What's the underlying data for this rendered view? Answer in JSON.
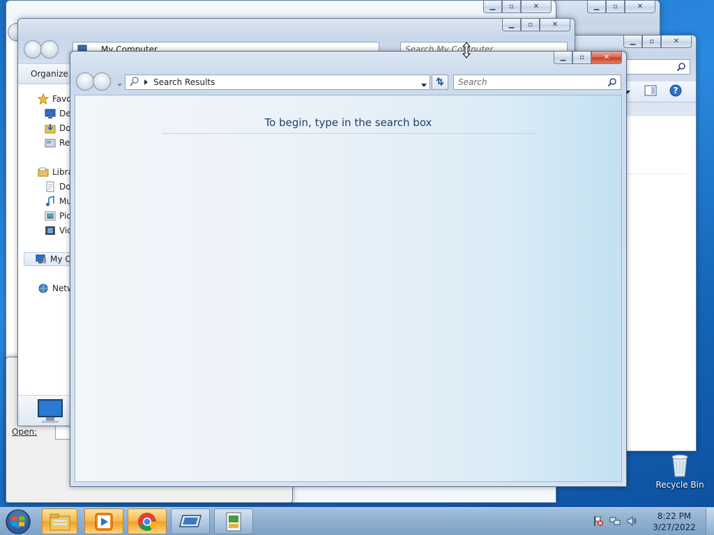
{
  "back_windows": {
    "explorer_address": "My Computer",
    "explorer_search_placeholder": "Search My Computer",
    "organize_label": "Organize",
    "nav": {
      "favorites": "Favo",
      "desktop": "Des",
      "downloads": "Dov",
      "recent": "Rec",
      "libraries": "Libra",
      "documents": "Do",
      "music": "Mu",
      "pictures": "Pic",
      "videos": "Vid",
      "my_computer": "My C",
      "network": "Netw"
    },
    "dialog_open_label": "Open:"
  },
  "front_window": {
    "address": "Search Results",
    "search_placeholder": "Search",
    "message": "To begin, type in the search box"
  },
  "desktop": {
    "recycle_bin": "Recycle Bin"
  },
  "taskbar": {
    "apps": [
      "windows-explorer",
      "media-player",
      "chrome",
      "remote-desktop",
      "control-panel"
    ],
    "time": "8:22 PM",
    "date": "3/27/2022"
  },
  "colors": {
    "accent": "#1e3e6d",
    "taskbar_active": "#f6b54a",
    "close_button": "#c23b22"
  }
}
